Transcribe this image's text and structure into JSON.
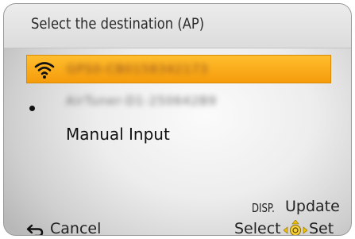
{
  "header": {
    "title": "Select the destination (AP)"
  },
  "networks": [
    {
      "ssid": "GPS0-CB0158342173",
      "selected": true,
      "icon": "wifi-icon"
    },
    {
      "ssid": "AirTuner-D1-250642B9",
      "selected": false,
      "icon": "dot-icon"
    }
  ],
  "manual_input": {
    "label": "Manual Input"
  },
  "footer": {
    "disp_key": "DISP.",
    "update_label": "Update",
    "cancel_label": "Cancel",
    "select_label": "Select",
    "set_label": "Set"
  },
  "colors": {
    "highlight": "#f8a81a",
    "dpad": "#f0c000"
  }
}
